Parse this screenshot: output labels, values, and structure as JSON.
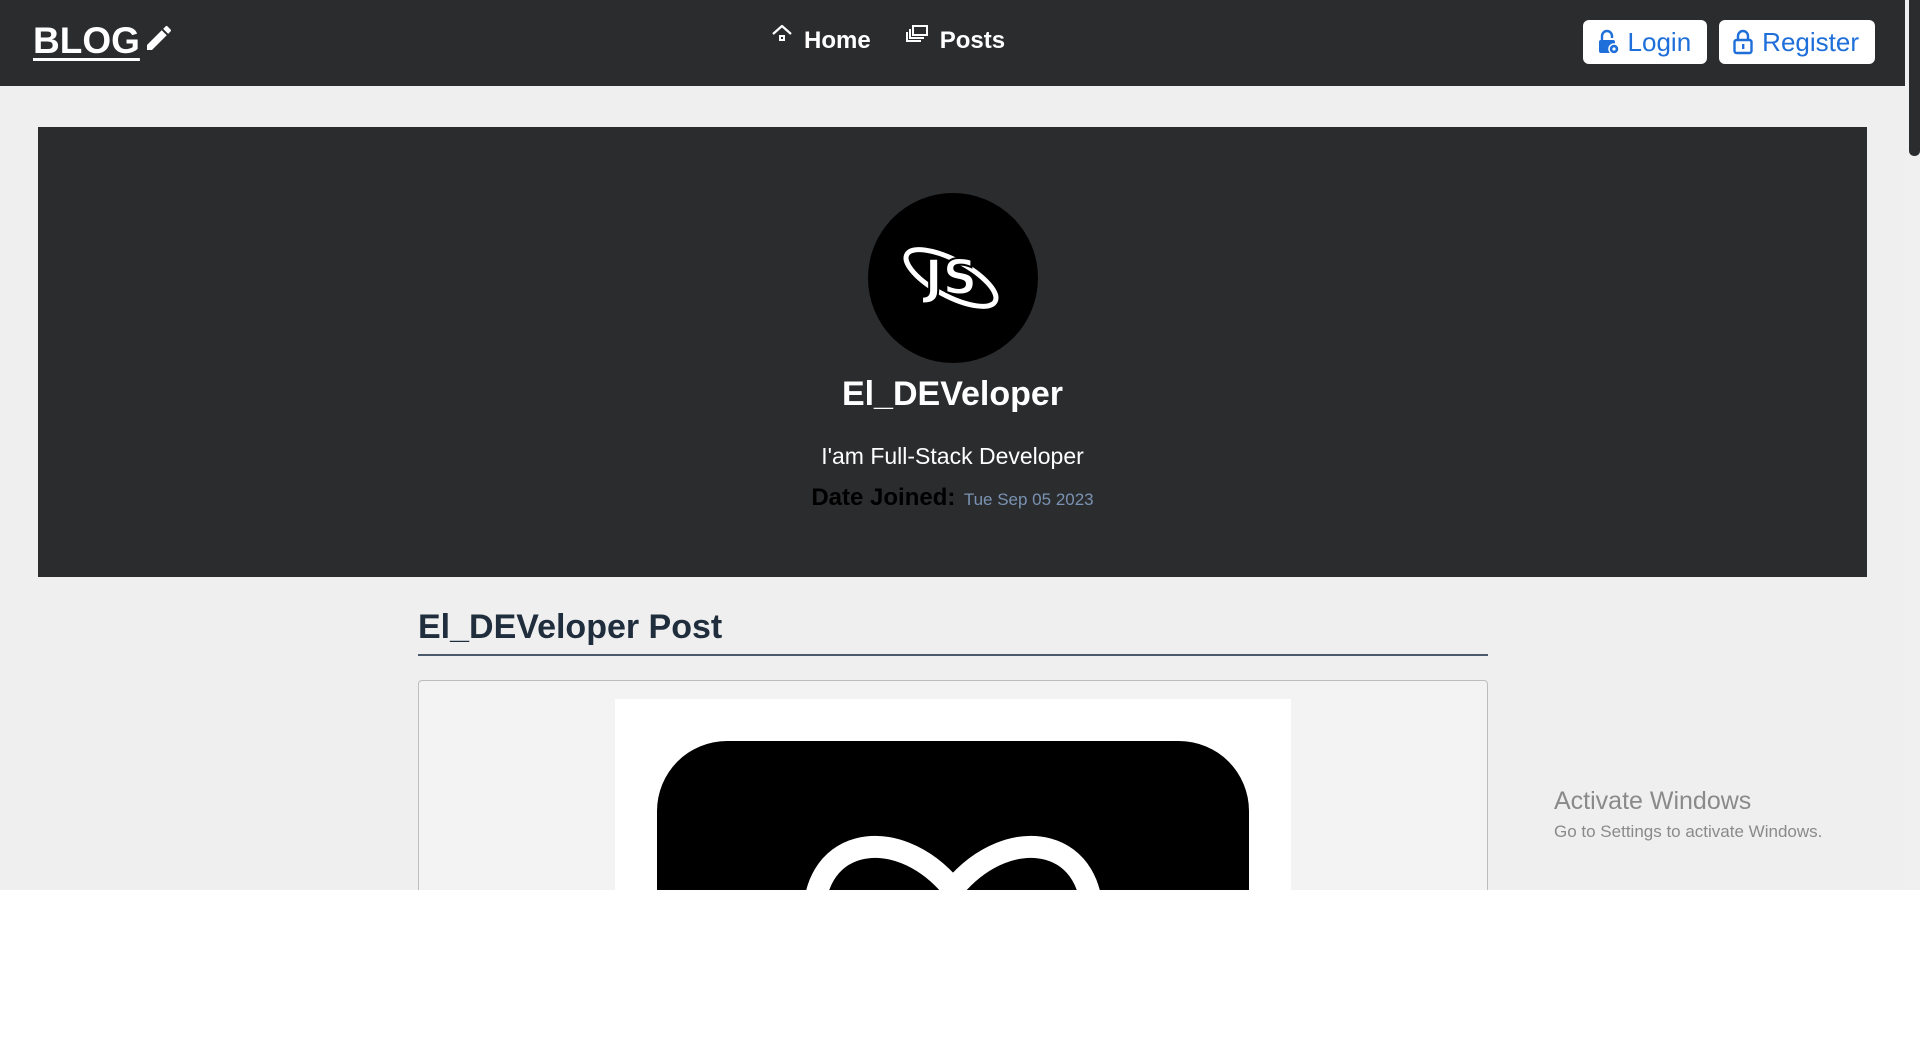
{
  "navbar": {
    "logo_text": "BLOG",
    "links": [
      {
        "label": "Home",
        "icon": "home-icon"
      },
      {
        "label": "Posts",
        "icon": "posts-icon"
      }
    ],
    "auth": [
      {
        "label": "Login",
        "icon": "lock-open-icon"
      },
      {
        "label": "Register",
        "icon": "lock-icon"
      }
    ]
  },
  "profile": {
    "avatar_text": "JS",
    "name": "El_DEVeloper",
    "bio": "I'am Full-Stack Developer",
    "date_label": "Date Joined:",
    "date_value": "Tue Sep 05 2023"
  },
  "posts_section": {
    "title": "El_DEVeloper Post"
  },
  "windows_notice": {
    "title": "Activate Windows",
    "subtitle": "Go to Settings to activate Windows."
  },
  "colors": {
    "navbar_bg": "#2b2c2e",
    "accent_blue": "#1e6fd9",
    "page_bg": "#efefef"
  }
}
